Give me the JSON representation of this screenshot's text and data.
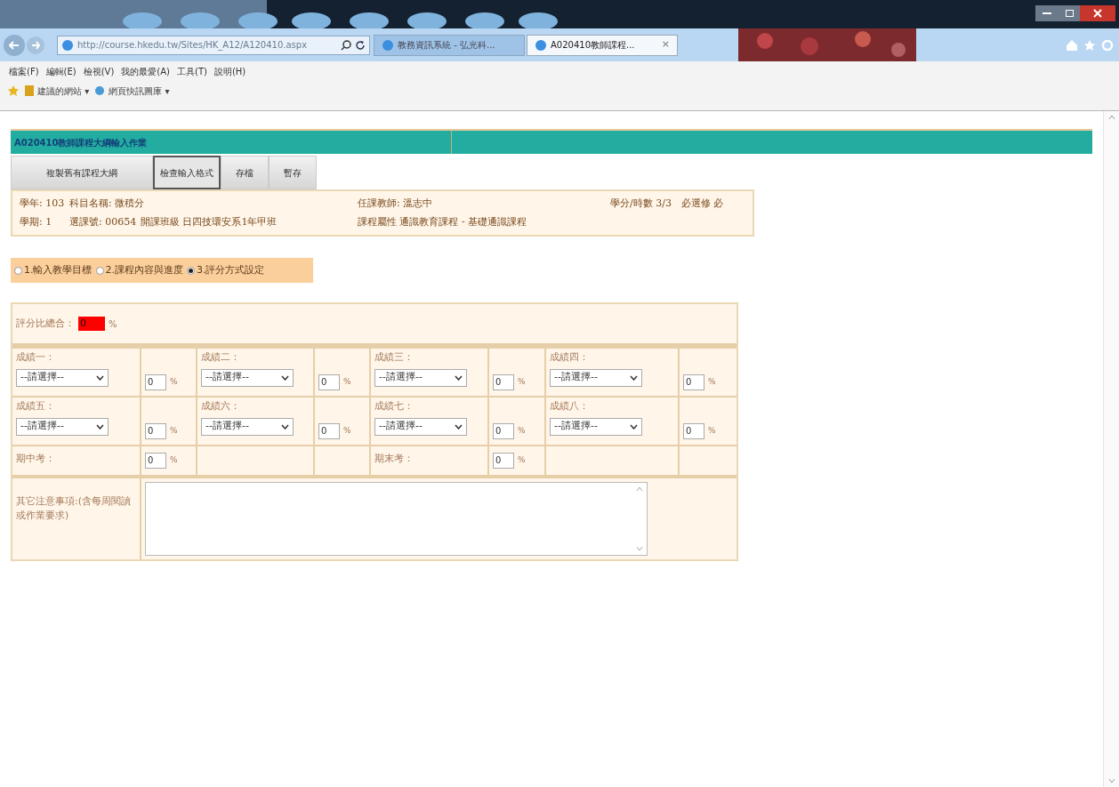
{
  "browser": {
    "address": "http://course.hkedu.tw/Sites/HK_A12/A120410.aspx",
    "tabs": [
      {
        "label": "教務資訊系統 - 弘光科...",
        "selected": false
      },
      {
        "label": "A020410教師課程...",
        "selected": true,
        "close": "×"
      }
    ],
    "menu": [
      "檔案(F)",
      "編輯(E)",
      "檢視(V)",
      "我的最愛(A)",
      "工具(T)",
      "說明(H)"
    ],
    "favorites": [
      "建議的網站 ▾",
      "網頁快訊圖庫 ▾"
    ]
  },
  "page": {
    "title": "A020410教師課程大綱輸入作業",
    "buttons": [
      {
        "label": "複製舊有課程大綱",
        "selected": false
      },
      {
        "label": "檢查輸入格式",
        "selected": true
      },
      {
        "label": "存檔",
        "selected": false
      },
      {
        "label": "暫存",
        "selected": false
      }
    ],
    "info": [
      [
        "學年: 103",
        "科目名稱: 微積分",
        "任課教師: 溫志中",
        "學分/時數 3/3",
        "必選修 必"
      ],
      [
        "學期: 1",
        "選課號: 00654",
        "開課班級 日四技環安系1年甲班",
        "課程屬性 通識教育課程 - 基礎通識課程"
      ]
    ],
    "steps": [
      {
        "label": "1.輸入教學目標",
        "selected": false
      },
      {
        "label": "2.課程內容與進度",
        "selected": false
      },
      {
        "label": "3.評分方式設定",
        "selected": true
      }
    ],
    "total": {
      "label": "評分比總合：",
      "value": "0",
      "unit": "%"
    },
    "grades": [
      [
        {
          "kind": "select",
          "label": "成績一：",
          "option": "--請選擇--",
          "value": "0",
          "unit": "%"
        },
        {
          "kind": "select",
          "label": "成績二：",
          "option": "--請選擇--",
          "value": "0",
          "unit": "%"
        },
        {
          "kind": "select",
          "label": "成績三：",
          "option": "--請選擇--",
          "value": "0",
          "unit": "%"
        },
        {
          "kind": "select",
          "label": "成績四：",
          "option": "--請選擇--",
          "value": "0",
          "unit": "%"
        }
      ],
      [
        {
          "kind": "select",
          "label": "成績五：",
          "option": "--請選擇--",
          "value": "0",
          "unit": "%"
        },
        {
          "kind": "select",
          "label": "成績六：",
          "option": "--請選擇--",
          "value": "0",
          "unit": "%"
        },
        {
          "kind": "select",
          "label": "成績七：",
          "option": "--請選擇--",
          "value": "0",
          "unit": "%"
        },
        {
          "kind": "select",
          "label": "成績八：",
          "option": "--請選擇--",
          "value": "0",
          "unit": "%"
        }
      ],
      [
        {
          "kind": "exam",
          "label": "期中考：",
          "value": "0",
          "unit": "%"
        },
        {
          "kind": "empty"
        },
        {
          "kind": "exam",
          "label": "期末考：",
          "value": "0",
          "unit": "%"
        },
        {
          "kind": "empty"
        }
      ]
    ],
    "notes": {
      "label": "其它注意事項:(含每周閱讀或作業要求)"
    }
  }
}
